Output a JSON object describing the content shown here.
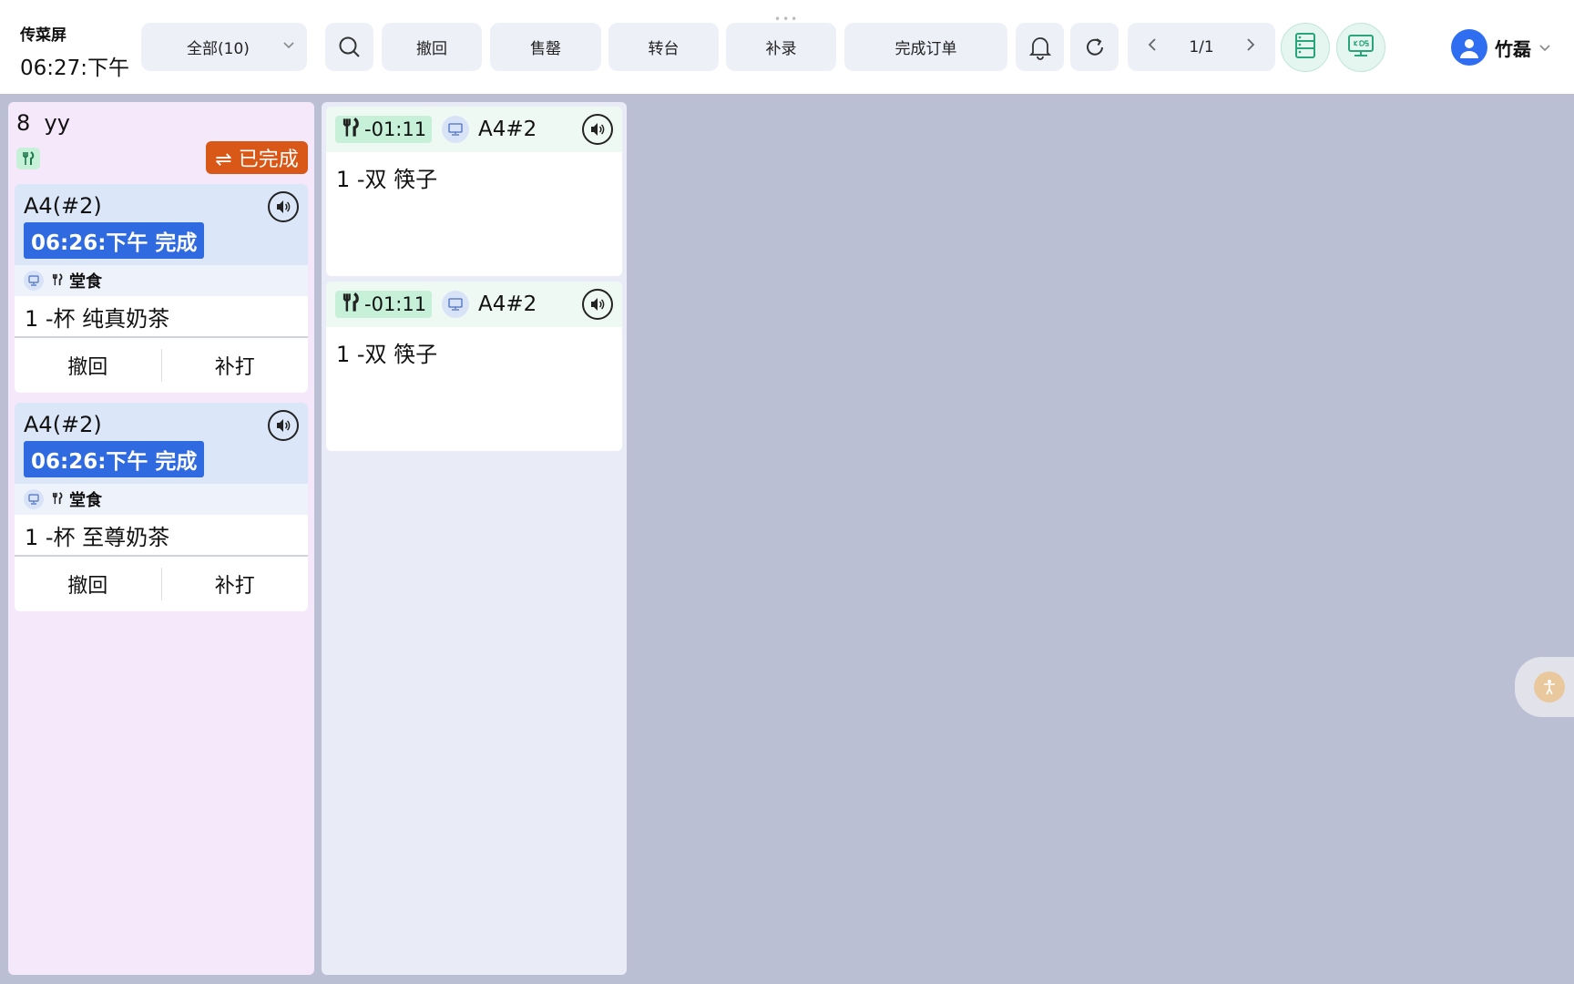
{
  "header": {
    "app_name": "传菜屏",
    "time": "06:27:下午",
    "filter_label": "全部(10)",
    "toolbar": {
      "recall": "撤回",
      "sold_out": "售罄",
      "transfer_table": "转台",
      "make_up": "补录",
      "complete_order": "完成订单"
    },
    "pager": "1/1",
    "user_name": "竹磊"
  },
  "column_completed": {
    "order_no": "8",
    "order_name": "yy",
    "status_label": "⇌ 已完成",
    "tickets": [
      {
        "table": "A4(#2)",
        "time_status": "06:26:下午 完成",
        "dine_type": "堂食",
        "item": "1 -杯 纯真奶茶",
        "actions": {
          "recall": "撤回",
          "reprint": "补打"
        }
      },
      {
        "table": "A4(#2)",
        "time_status": "06:26:下午 完成",
        "dine_type": "堂食",
        "item": "1 -杯 至尊奶茶",
        "actions": {
          "recall": "撤回",
          "reprint": "补打"
        }
      }
    ]
  },
  "column_pending": {
    "cards": [
      {
        "timer": "-01:11",
        "table": "A4#2",
        "item": "1 -双 筷子"
      },
      {
        "timer": "-01:11",
        "table": "A4#2",
        "item": "1 -双 筷子"
      }
    ]
  },
  "colors": {
    "accent_blue": "#2f6ae0",
    "done_orange": "#d95818",
    "green_tag": "#c6f0d7",
    "page_bg": "#bbbfd4"
  },
  "icons": {
    "search": "search-icon",
    "bell": "bell-icon",
    "refresh": "refresh-icon",
    "prev": "chevron-left-icon",
    "next": "chevron-right-icon",
    "server": "server-icon",
    "kds": "kds-monitor-icon",
    "speaker": "speaker-icon",
    "fork_knife": "fork-knife-icon",
    "pos": "pos-icon",
    "accessibility": "accessibility-icon"
  }
}
